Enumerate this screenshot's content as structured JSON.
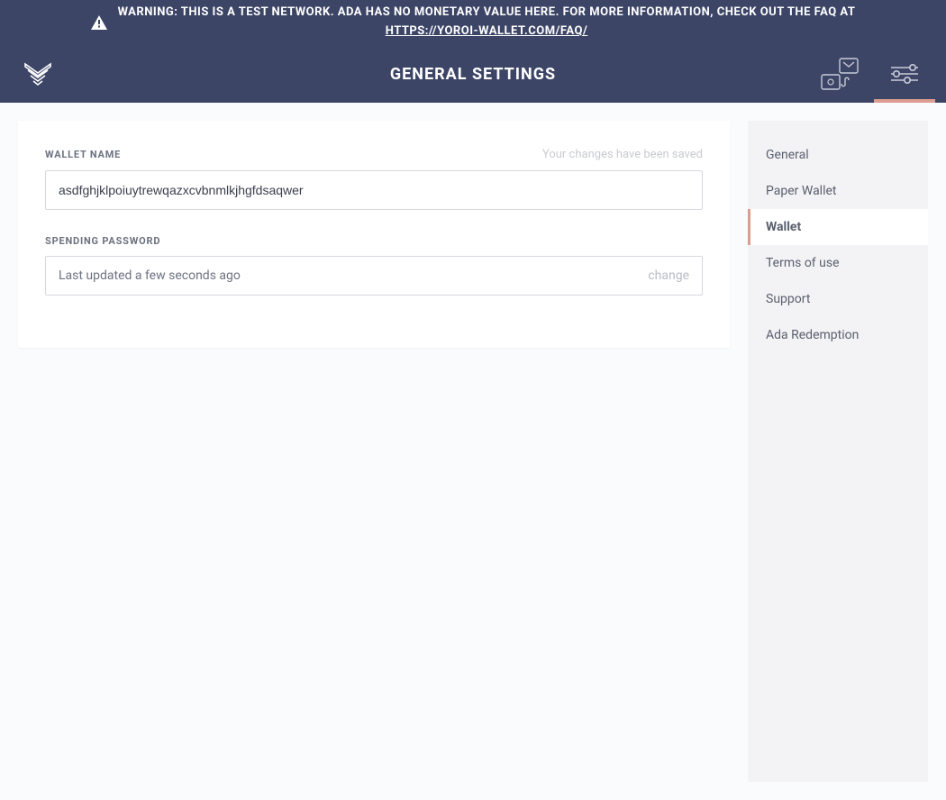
{
  "warning": {
    "text": "WARNING: THIS IS A TEST NETWORK. ADA HAS NO MONETARY VALUE HERE. FOR MORE INFORMATION, CHECK OUT THE FAQ AT",
    "link_text": "HTTPS://YOROI-WALLET.COM/FAQ/"
  },
  "header": {
    "title": "GENERAL SETTINGS"
  },
  "wallet_name": {
    "label": "WALLET NAME",
    "value": "asdfghjklpoiuytrewqazxcvbnmlkjhgfdsaqwer",
    "status": "Your changes have been saved"
  },
  "spending_password": {
    "label": "SPENDING PASSWORD",
    "status_text": "Last updated a few seconds ago",
    "change_label": "change"
  },
  "nav": {
    "items": [
      {
        "label": "General"
      },
      {
        "label": "Paper Wallet"
      },
      {
        "label": "Wallet"
      },
      {
        "label": "Terms of use"
      },
      {
        "label": "Support"
      },
      {
        "label": "Ada Redemption"
      }
    ],
    "active_index": 2
  },
  "colors": {
    "accent": "#da9d8f",
    "header_bg": "#3d4566"
  }
}
